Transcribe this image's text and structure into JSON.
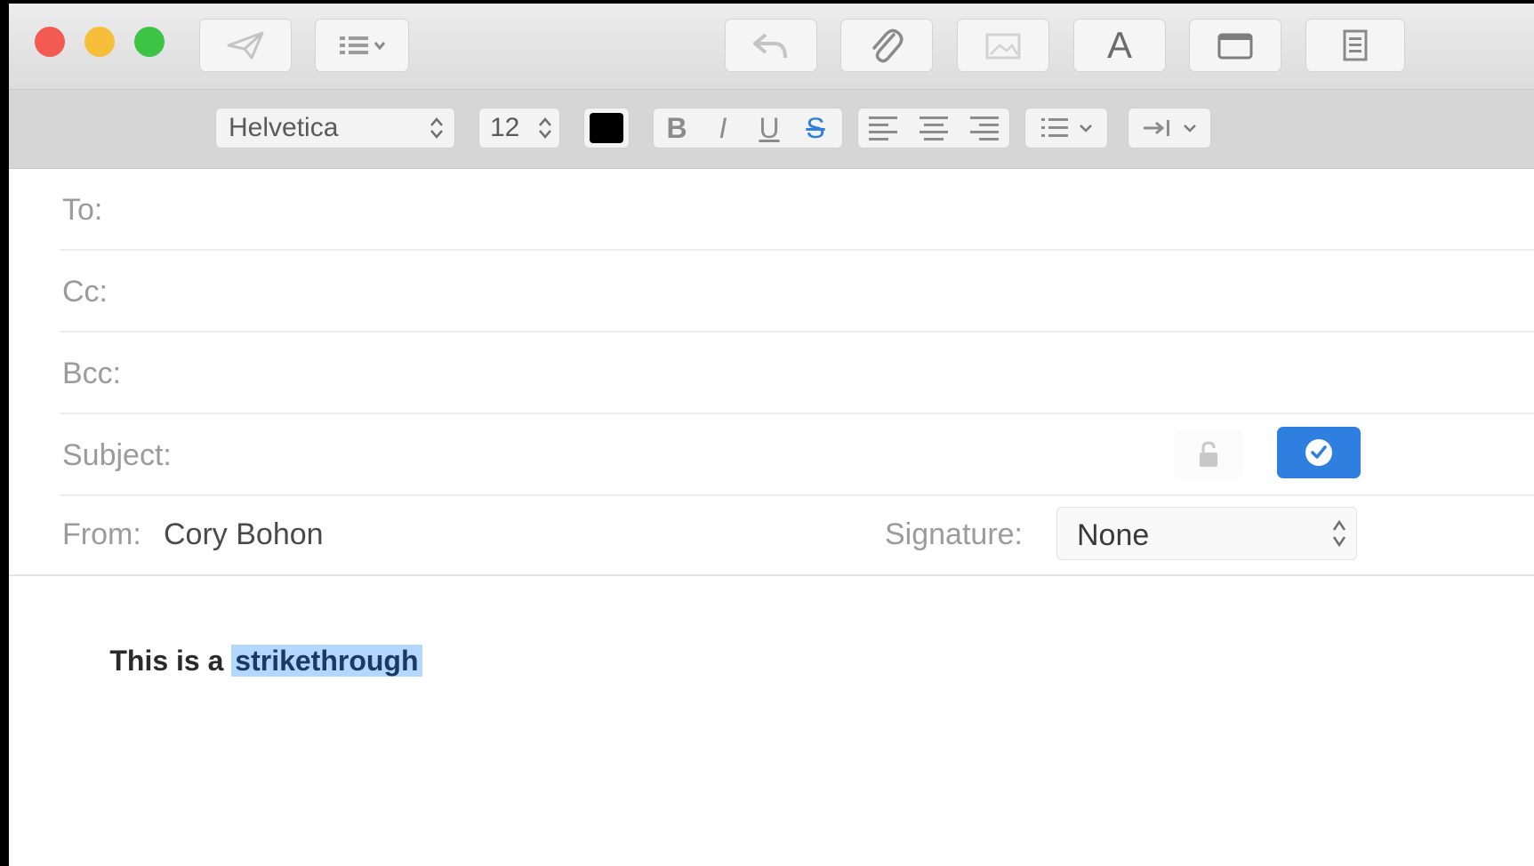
{
  "format_bar": {
    "font_name": "Helvetica",
    "font_size": "12",
    "bold_label": "B",
    "italic_label": "I",
    "underline_label": "U",
    "strikethrough_label": "S",
    "text_color": "#000000"
  },
  "toolbar": {
    "font_button_label": "A"
  },
  "header": {
    "to_label": "To:",
    "cc_label": "Cc:",
    "bcc_label": "Bcc:",
    "subject_label": "Subject:",
    "from_label": "From:",
    "from_value": "Cory Bohon",
    "signature_label": "Signature:",
    "signature_value": "None"
  },
  "body": {
    "text_before": "This is a ",
    "text_selected": "strikethrough"
  },
  "colors": {
    "close": "#f25a52",
    "minimize": "#f6be3b",
    "zoom": "#3ec445",
    "accent": "#2f7fe0",
    "selection": "#b3d7ff"
  },
  "icons": [
    "send-icon",
    "header-fields-icon",
    "reply-icon",
    "paperclip-icon",
    "photo-icon",
    "font-icon",
    "window-icon",
    "document-icon",
    "lock-icon",
    "checkmark-icon"
  ]
}
